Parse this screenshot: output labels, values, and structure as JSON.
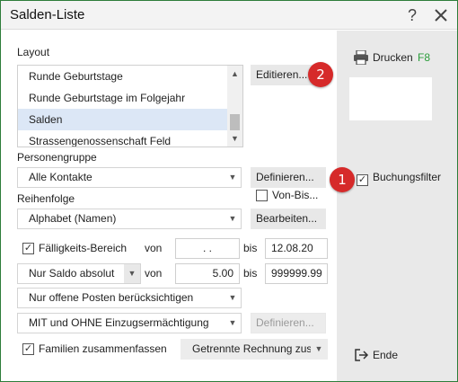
{
  "window": {
    "title": "Salden-Liste",
    "help_icon": "question-icon",
    "close_icon": "close-icon"
  },
  "layout": {
    "label": "Layout",
    "items": [
      "Runde Geburtstage",
      "Runde Geburtstage im Folgejahr",
      "Salden",
      "Strassengenossenschaft Feld"
    ],
    "selected_index": 2,
    "edit_button": "Editieren...",
    "badge": "2"
  },
  "personengruppe": {
    "label": "Personengruppe",
    "value": "Alle Kontakte",
    "define_button": "Definieren...",
    "von_bis_label": "Von-Bis..."
  },
  "reihenfolge": {
    "label": "Reihenfolge",
    "value": "Alphabet (Namen)",
    "edit_button": "Bearbeiten..."
  },
  "faelligkeit": {
    "checkbox_label": "Fälligkeits-Bereich",
    "checked": true,
    "von_label": "von",
    "from_value": ". .",
    "bis_label": "bis",
    "to_value": "12.08.20"
  },
  "saldo": {
    "mode": "Nur Saldo absolut",
    "von_label": "von",
    "from_value": "5.00",
    "bis_label": "bis",
    "to_value": "999999.99"
  },
  "offene_posten": {
    "value": "Nur offene Posten berücksichtigen"
  },
  "einzug": {
    "value": "MIT und OHNE Einzugsermächtigung",
    "define_button": "Definieren..."
  },
  "familien": {
    "checkbox_label": "Familien zusammenfassen",
    "checked": true,
    "rechnung_value": "Getrennte Rechnung zusa"
  },
  "sidebar": {
    "print_label": "Drucken",
    "print_shortcut": "F8",
    "print_icon": "printer-icon",
    "filter_label": "Buchungsfilter",
    "filter_checked": true,
    "badge": "1",
    "end_label": "Ende",
    "end_icon": "exit-icon"
  },
  "colors": {
    "accent_border": "#2e7d3a",
    "badge": "#d62a2a",
    "selection": "#dce7f6",
    "shortcut": "#2a9d3a"
  }
}
